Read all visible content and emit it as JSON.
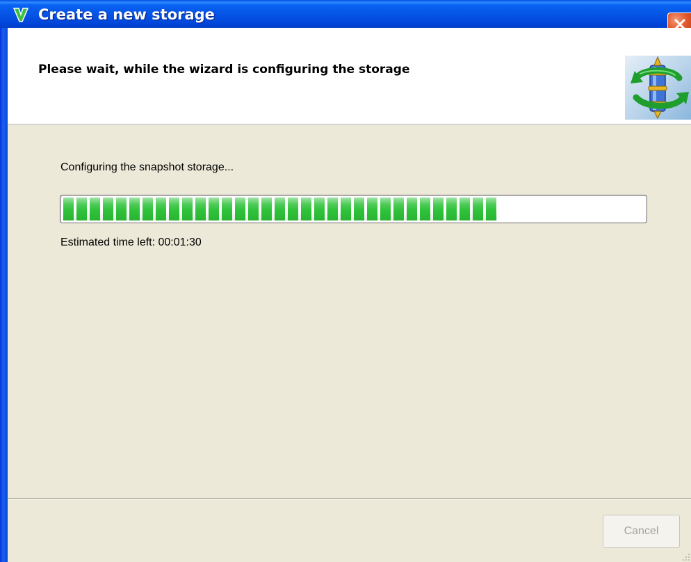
{
  "window": {
    "title": "Create a new storage",
    "title_bar_color": "#0555e6",
    "close_icon": "close-icon",
    "app_icon": "green-v-icon"
  },
  "header": {
    "title": "Please wait, while the wizard is configuring the storage",
    "logo_icon": "storage-sync-logo-icon"
  },
  "body": {
    "status_text": "Configuring the snapshot storage...",
    "progress": {
      "fraction": 0.74,
      "fill_color": "#2fc23a"
    },
    "time_left_text": "Estimated time left: 00:01:30"
  },
  "footer": {
    "cancel_label": "Cancel",
    "cancel_enabled": false
  }
}
